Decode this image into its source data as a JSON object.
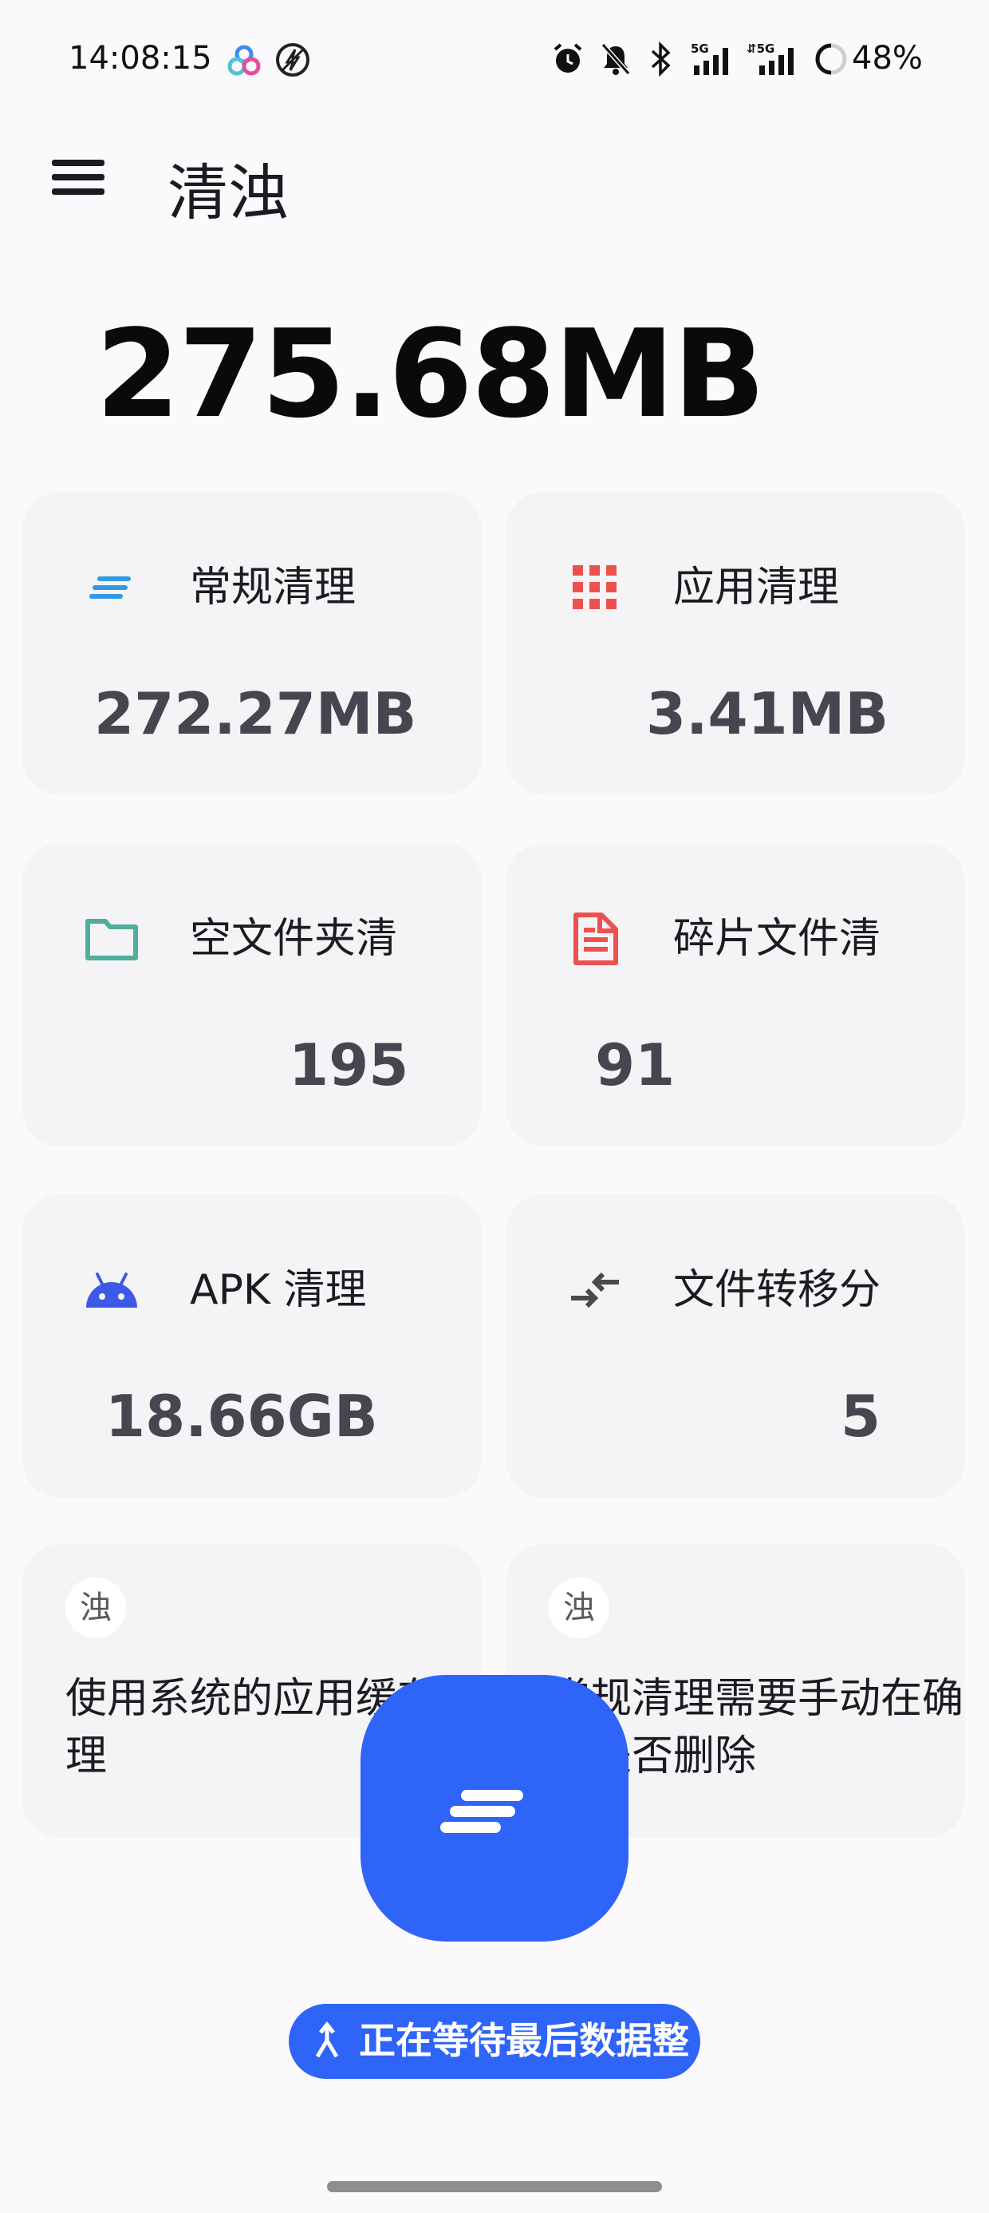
{
  "status_bar": {
    "time": "14:08:15",
    "battery": "48%",
    "icons": [
      "cloud-app-icon",
      "no-charge-icon",
      "alarm-icon",
      "bell-off-icon",
      "bluetooth-icon",
      "signal-5g-icon",
      "signal-5g-2-icon",
      "battery-ring-icon"
    ]
  },
  "toolbar": {
    "menu_icon": "hamburger-menu-icon",
    "title": "清浊"
  },
  "summary": {
    "total_size": "275.68MB"
  },
  "cards": [
    {
      "id": "regular",
      "label": "常规清理",
      "value": "272.27MB",
      "icon": "sort-lines-icon",
      "icon_color": "#3399e0"
    },
    {
      "id": "app",
      "label": "应用清理",
      "value": "3.41MB",
      "icon": "grid-apps-icon",
      "icon_color": "#ef4f4f"
    },
    {
      "id": "empty-folder",
      "label": "空文件夹清",
      "value": "195",
      "icon": "folder-icon",
      "icon_color": "#4fae9c"
    },
    {
      "id": "fragment",
      "label": "碎片文件清",
      "value": "91",
      "icon": "document-icon",
      "icon_color": "#ef4f4f"
    },
    {
      "id": "apk",
      "label": "APK 清理",
      "value": "18.66GB",
      "icon": "android-icon",
      "icon_color": "#3d5ae6"
    },
    {
      "id": "file-transfer",
      "label": "文件转移分",
      "value": "5",
      "icon": "swap-arrows-icon",
      "icon_color": "#4a4a4a"
    }
  ],
  "info_cards": [
    {
      "avatar_text": "浊",
      "text": "使用系统的应用缓存清理"
    },
    {
      "avatar_text": "浊",
      "text": "常规清理需要手动在确认是否删除"
    }
  ],
  "fab": {
    "icon": "clean-sort-icon"
  },
  "status_chip": {
    "icon": "merge-arrow-icon",
    "text": "正在等待最后数据整"
  }
}
